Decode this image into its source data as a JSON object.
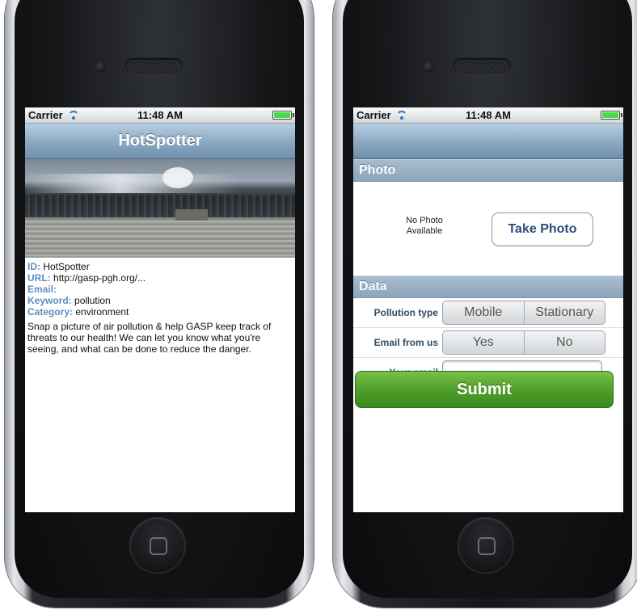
{
  "left_screen": {
    "status": {
      "carrier": "Carrier",
      "time": "11:48 AM"
    },
    "title": "HotSpotter",
    "info": {
      "id_label": "ID:",
      "id_value": "HotSpotter",
      "url_label": "URL:",
      "url_value": "http://gasp-pgh.org/...",
      "email_label": "Email:",
      "keyword_label": "Keyword:",
      "keyword_value": "pollution",
      "category_label": "Category:",
      "category_value": "environment",
      "description": "Snap a picture of air pollution & help GASP keep track of threats to our health! We can let you know what you're seeing, and what can be done to reduce the danger."
    },
    "accent_color": "#5b8fbf"
  },
  "right_screen": {
    "status": {
      "carrier": "Carrier",
      "time": "11:48 AM"
    },
    "photo_section": "Photo",
    "no_photo": "No Photo Available",
    "take_photo": "Take Photo",
    "data_section": "Data",
    "pollution_type": {
      "label": "Pollution type",
      "options": [
        "Mobile",
        "Stationary"
      ]
    },
    "email_from_us": {
      "label": "Email from us",
      "options": [
        "Yes",
        "No"
      ]
    },
    "your_email": {
      "label": "Your email",
      "value": ""
    },
    "submit": "Submit",
    "submit_color": "#4f9e2b"
  }
}
